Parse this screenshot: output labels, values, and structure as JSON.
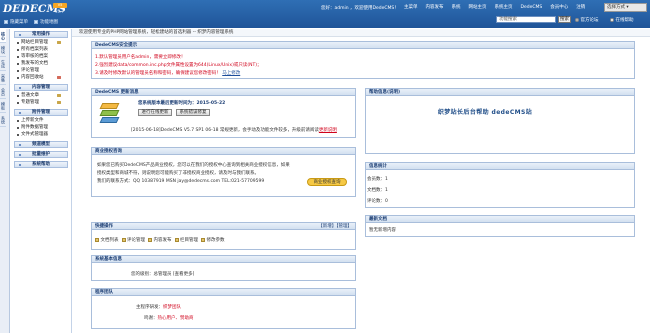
{
  "header": {
    "logo_text": "DEDECMS",
    "logo_badge": "V5",
    "logo_version": "v5.7",
    "hide_menu_label": "隐藏菜单",
    "function_map_label": "功能地图",
    "greeting": "您好：admin ，欢迎使用DedeCMS！",
    "nav": [
      "主菜单",
      "内容发布",
      "系统",
      "网站主页",
      "系统主页",
      "DedeCMS",
      "会员中心",
      "注销"
    ],
    "style_select": "选择方式 ▾",
    "search_placeholder": "功能搜索",
    "search_button": "搜索",
    "radio_official": "官方论坛",
    "radio_online": "在线帮助"
  },
  "sidebar_tabs": [
    "核心",
    "模块",
    "生成",
    "采集",
    "会员",
    "模板",
    "系统"
  ],
  "menu": {
    "groups": [
      {
        "title": "常用操作",
        "items": [
          "网站栏目管理",
          "所有档案列表",
          "等审核的档案",
          "我发布的文档",
          "评论管理",
          "内容回收站"
        ]
      },
      {
        "title": "内容管理",
        "items": [
          "普通文章",
          "专题管理"
        ]
      },
      {
        "title": "附件管理",
        "items": [
          "上传新文件",
          "附件数据管理",
          "文件式管理器"
        ]
      },
      {
        "title": "频道模型"
      },
      {
        "title": "批量维护"
      },
      {
        "title": "系统帮助"
      }
    ]
  },
  "topline": "欢迎使用专业的PHP网站管理系统，轻松建站的首选利器 -- 织梦内容管理系统",
  "security": {
    "title": "DedeCMS安全提示",
    "line1": "1.默认管理员用户名admin，需要立即修改！",
    "line2": "2.强烈建议data/common.inc.php文件属性设置为644(Linux/Unix)或只读(NT)；",
    "line3": "3.请及时修改默认的管理员名称和密码，确保建议您修改密码！",
    "line3_link": "马上修改"
  },
  "update": {
    "title": "DedeCMS 更新消息",
    "headline": "您系统版本最后更新时间为：2015-05-22",
    "btn_check": "进行在线更新",
    "btn_fix": "系统错误修复",
    "note": "[2015-06-18]DedeCMS V5.7 SP1 06-18 常规更新，会手动及功能文件较多，升级前请阅读",
    "note_link": "更新说明"
  },
  "commercial": {
    "title": "商业授权咨询",
    "text1": "如果您已购买DedeCMS产品商业授权，您可以在我们的授权中心查询到相关商业授权信息，如果",
    "text2": "授权类型和商城不符，则说明您可能购买了非授权商业授权，请及时与我们联系。",
    "text3": "我们的联系方式：QQ 10387919 MSN jay@dedecms.com TEL:021-57709599",
    "button": "商业授权查询"
  },
  "quick": {
    "title": "快捷操作",
    "links": "【新增】【管理】",
    "items": [
      "文档列表",
      "评论管理",
      "内容发布",
      "栏目管理",
      "修改参数"
    ]
  },
  "sysinfo": {
    "title": "系统基本信息",
    "label": "您的级别：",
    "value": "总管理员 [查看更多]"
  },
  "team": {
    "title": "程序团队",
    "label1": "主程序研发：",
    "value1": "织梦团队",
    "label2": "鸣谢：",
    "value2": "热心用户、赞助商"
  },
  "help": {
    "title": "帮助信息(说明)",
    "banner": "织梦站长后台帮助  dedeCMS站"
  },
  "stats": {
    "title": "信息统计",
    "rows": [
      {
        "label": "会员数：",
        "value": "1"
      },
      {
        "label": "文档数：",
        "value": "1"
      },
      {
        "label": "评论数：",
        "value": "0"
      }
    ]
  },
  "recent": {
    "title": "最新文档",
    "empty": "暂无新增内容"
  }
}
